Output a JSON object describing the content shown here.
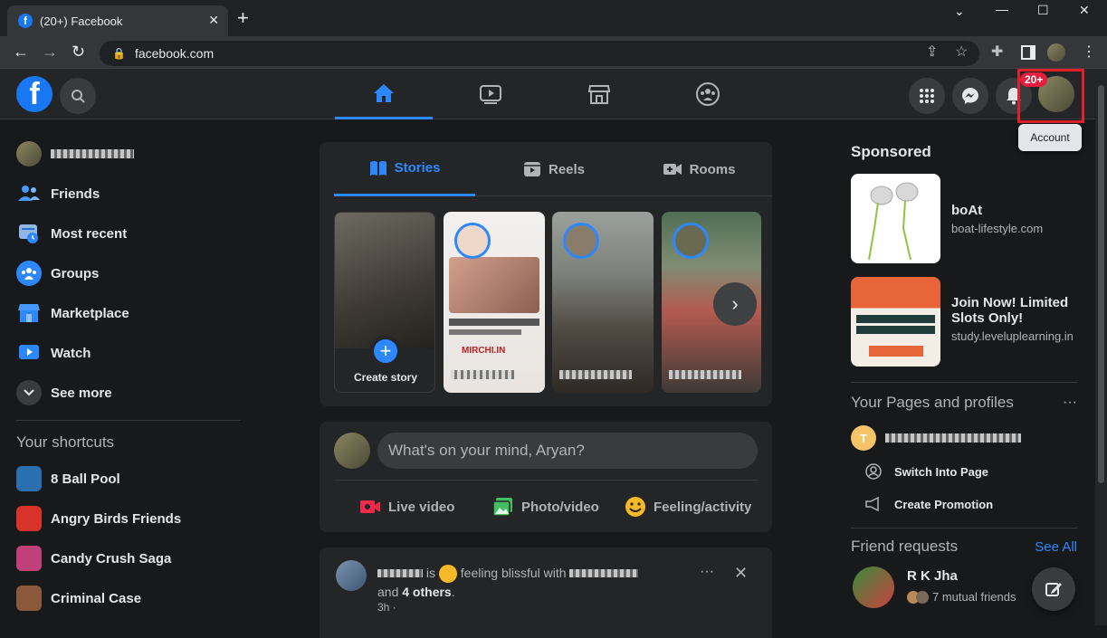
{
  "browser": {
    "tab_title": "(20+) Facebook",
    "url": "facebook.com",
    "new_tab": "+",
    "tab_close": "✕"
  },
  "header": {
    "badge": "20+",
    "tooltip": "Account"
  },
  "left_nav": {
    "user_name": "Aryan Jha",
    "items": [
      {
        "label": "Friends",
        "icon": "friends-icon"
      },
      {
        "label": "Most recent",
        "icon": "most-recent-icon"
      },
      {
        "label": "Groups",
        "icon": "groups-icon"
      },
      {
        "label": "Marketplace",
        "icon": "marketplace-icon"
      },
      {
        "label": "Watch",
        "icon": "watch-icon"
      },
      {
        "label": "See more",
        "icon": "chevron-down-icon"
      }
    ],
    "shortcuts_title": "Your shortcuts",
    "shortcuts": [
      {
        "label": "8 Ball Pool",
        "color": "#2a6fb0"
      },
      {
        "label": "Angry Birds Friends",
        "color": "#d8332b"
      },
      {
        "label": "Candy Crush Saga",
        "color": "#c0417a"
      },
      {
        "label": "Criminal Case",
        "color": "#8b5a3c"
      }
    ]
  },
  "stories": {
    "tabs": [
      "Stories",
      "Reels",
      "Rooms"
    ],
    "create_label": "Create story",
    "items": [
      "MIRCHI.IN",
      "Story",
      "Story"
    ],
    "next": "›"
  },
  "composer": {
    "placeholder": "What's on your mind, Aryan?",
    "actions": [
      "Live video",
      "Photo/video",
      "Feeling/activity"
    ]
  },
  "feed_post": {
    "author": "Ashwin Jha",
    "is": "is",
    "feeling": "feeling blissful with",
    "and": "and",
    "others": "4 others",
    "period": ".",
    "time": "3h ·",
    "more": "···",
    "close": "✕"
  },
  "right": {
    "sponsored_title": "Sponsored",
    "ads": [
      {
        "title": "boAt",
        "url": "boat-lifestyle.com"
      },
      {
        "title": "Join Now! Limited Slots Only!",
        "url": "study.leveluplearning.in"
      }
    ],
    "pages_title": "Your Pages and profiles",
    "pages_more": "···",
    "page_initial": "T",
    "page_actions": [
      "Switch Into Page",
      "Create Promotion"
    ],
    "friend_requests_title": "Friend requests",
    "see_all": "See All",
    "request_name": "R K Jha",
    "request_mutual": "7 mutual friends"
  }
}
